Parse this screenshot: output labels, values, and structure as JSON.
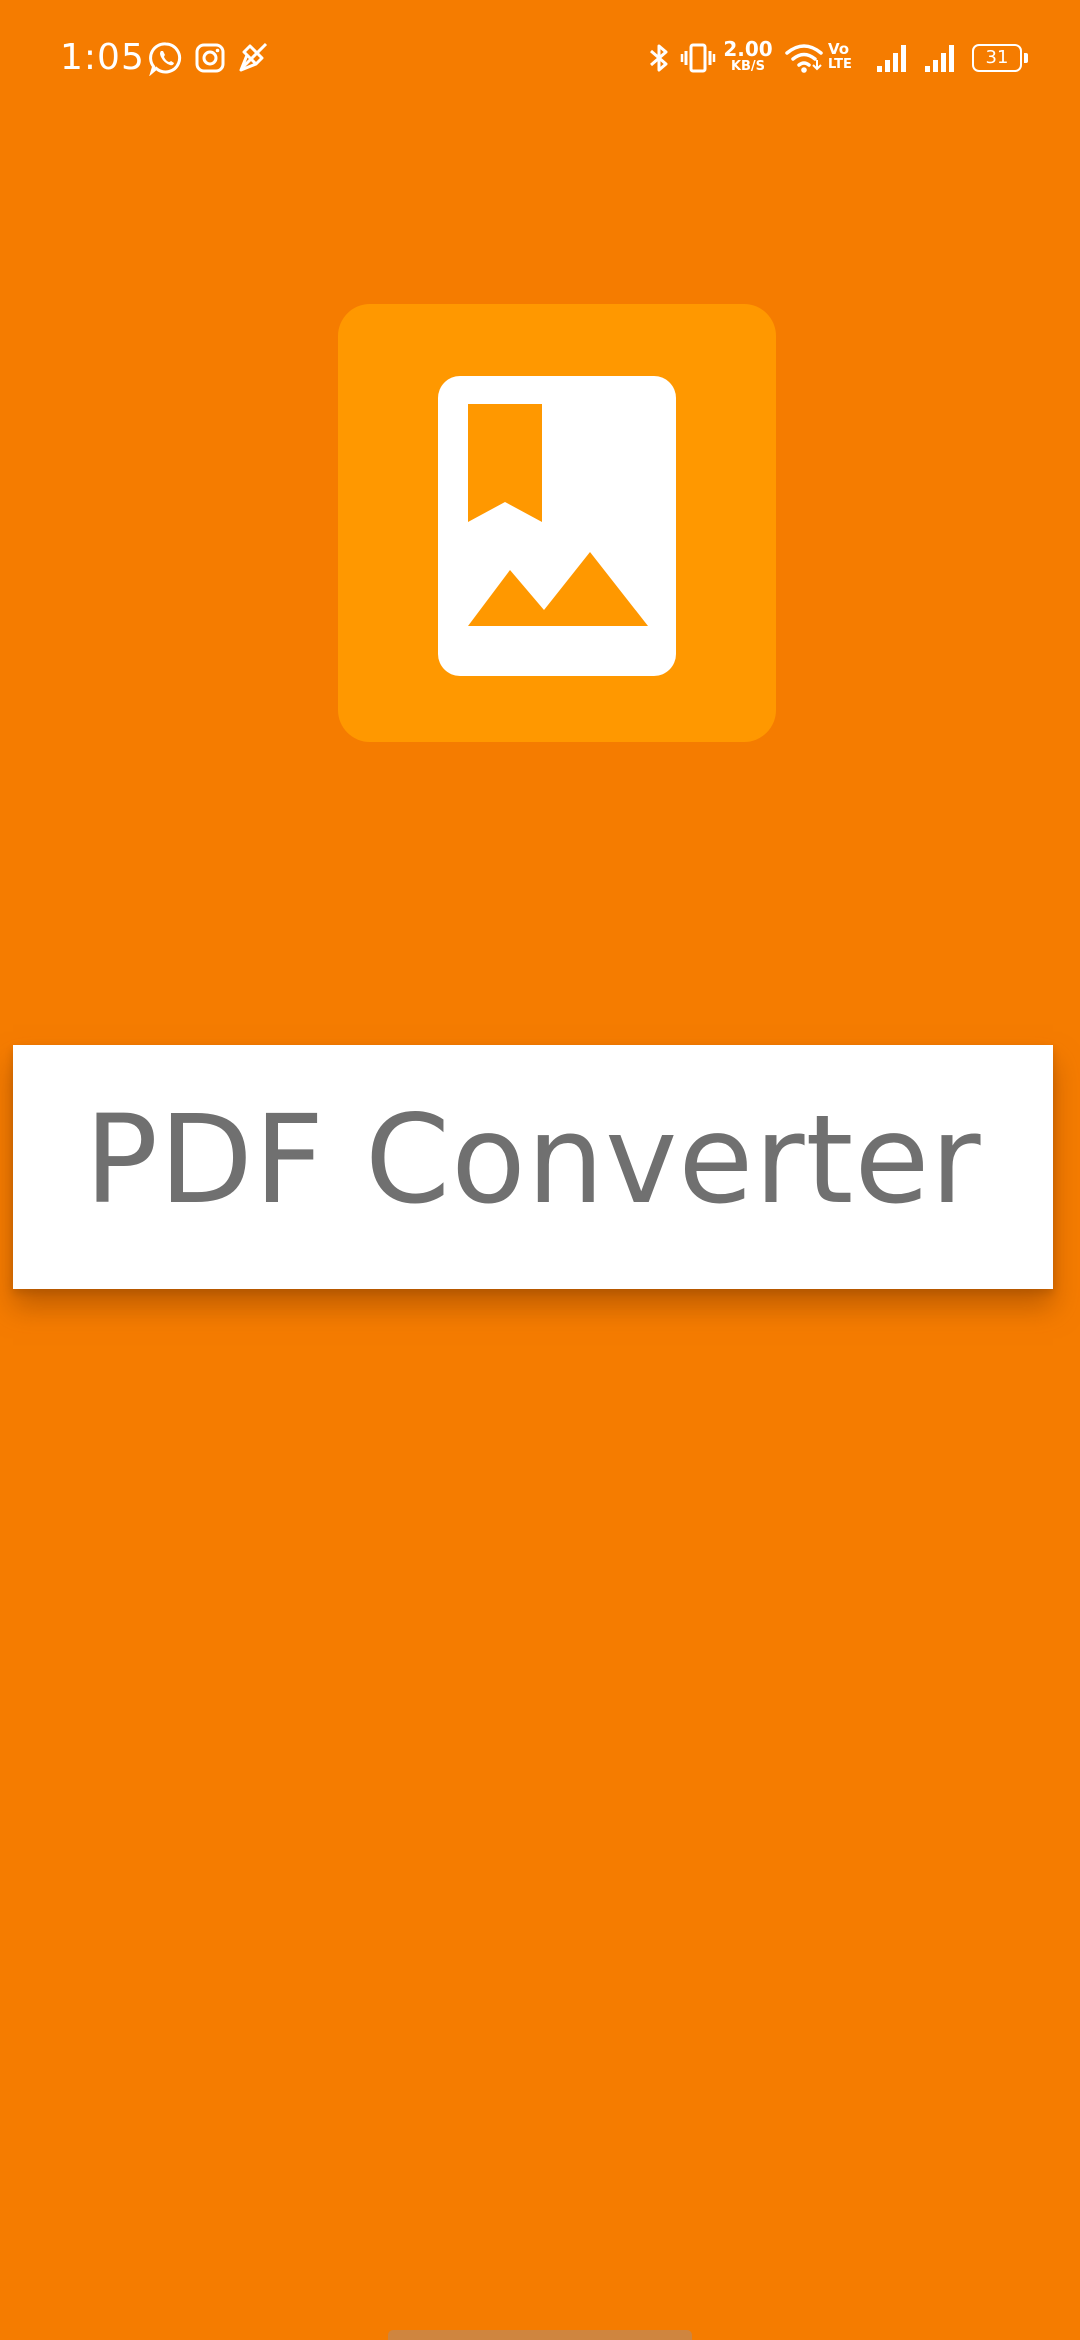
{
  "status_bar": {
    "time": "1:05",
    "left_icons": [
      "whatsapp-icon",
      "instagram-icon",
      "mute-mic-icon"
    ],
    "right_icons": [
      "bluetooth-icon",
      "vibrate-icon",
      "wifi-icon",
      "signal-icon",
      "signal-icon"
    ],
    "network_speed": "2.00",
    "network_speed_unit": "KB/S",
    "volte_top": "Vo",
    "volte_bottom": "LTE",
    "battery_level": "31"
  },
  "app": {
    "title": "PDF Converter",
    "logo_icon": "pdf-image-document-icon"
  },
  "colors": {
    "background": "#F57C00",
    "logo_background": "#FF9800",
    "card_background": "#FFFFFF",
    "title_text": "#707070",
    "icon_foreground": "#FFFFFF"
  }
}
